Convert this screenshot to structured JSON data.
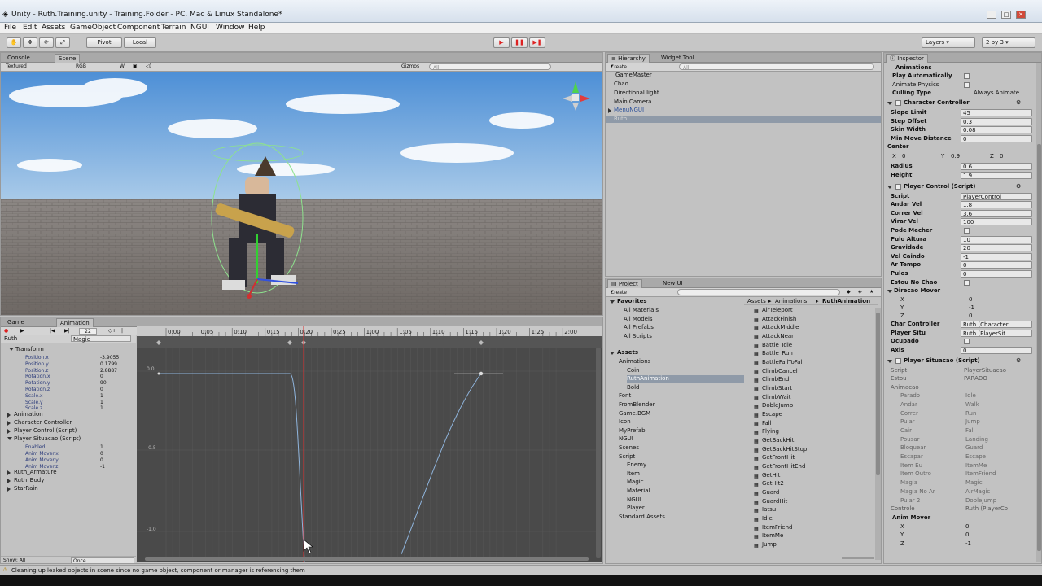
{
  "window": {
    "title": "Unity - Ruth.Training.unity - Training.Folder - PC, Mac & Linux Standalone*"
  },
  "menu": [
    "File",
    "Edit",
    "Assets",
    "GameObject",
    "Component",
    "Terrain",
    "NGUI",
    "Window",
    "Help"
  ],
  "toolbar": {
    "pivot": "Pivot",
    "local": "Local",
    "layers": "Layers",
    "layout": "2 by 3"
  },
  "scene": {
    "tabs": [
      "Console",
      "Scene"
    ],
    "shading": "Textured",
    "render": "RGB",
    "gizmos": "Gizmos",
    "search": "All"
  },
  "hierarchy": {
    "tabs": [
      "Hierarchy",
      "Widget Tool"
    ],
    "create": "Create",
    "search": "All",
    "items": [
      "GameMaster",
      "Chao",
      "Directional light",
      "Main Camera",
      "MenuNGUI",
      "Ruth"
    ]
  },
  "project": {
    "tabs": [
      "Project",
      "New UI"
    ],
    "create": "Create",
    "favorites": "Favorites",
    "fav_items": [
      "All Materials",
      "All Models",
      "All Prefabs",
      "All Scripts"
    ],
    "assets": "Assets",
    "tree": [
      "Animations",
      "Coin",
      "RuthAnimation",
      "Bold",
      "Font",
      "FromBlender",
      "Game.BGM",
      "Icon",
      "MyPrefab",
      "NGUI",
      "Scenes",
      "Script",
      "Enemy",
      "Item",
      "Magic",
      "Material",
      "NGUI",
      "Player",
      "Standard Assets"
    ],
    "breadcrumb": [
      "Assets",
      "Animations",
      "RuthAnimation"
    ],
    "files": [
      "AirTeleport",
      "AttackFinish",
      "AttackMiddle",
      "AttackNear",
      "Battle_Idle",
      "Battle_Run",
      "BattleFallToFall",
      "ClimbCancel",
      "ClimbEnd",
      "ClimbStart",
      "ClimbWait",
      "DobleJump",
      "Escape",
      "Fall",
      "Flying",
      "GetBackHit",
      "GetBackHitStop",
      "GetFrontHit",
      "GetFrontHitEnd",
      "GetHit",
      "GetHit2",
      "Guard",
      "GuardHit",
      "Iatsu",
      "Idle",
      "ItemFriend",
      "ItemMe",
      "Jump"
    ]
  },
  "animation": {
    "tabs": [
      "Game",
      "Animation"
    ],
    "frame": "22",
    "clip": "Magic",
    "object": "Ruth",
    "times": [
      "0:00",
      "0:05",
      "0:10",
      "0:15",
      "0:20",
      "0:25",
      "1:00",
      "1:05",
      "1:10",
      "1:15",
      "1:20",
      "1:25",
      "2:00"
    ],
    "props": [
      {
        "name": "Transform",
        "value": ""
      },
      {
        "name": "Position.x",
        "value": "-3.9055"
      },
      {
        "name": "Position.y",
        "value": "0.1799"
      },
      {
        "name": "Position.z",
        "value": "2.8887"
      },
      {
        "name": "Rotation.x",
        "value": "0"
      },
      {
        "name": "Rotation.y",
        "value": "90"
      },
      {
        "name": "Rotation.z",
        "value": "0"
      },
      {
        "name": "Scale.x",
        "value": "1"
      },
      {
        "name": "Scale.y",
        "value": "1"
      },
      {
        "name": "Scale.z",
        "value": "1"
      },
      {
        "name": "Animation",
        "value": ""
      },
      {
        "name": "Character Controller",
        "value": ""
      },
      {
        "name": "Player Control (Script)",
        "value": ""
      },
      {
        "name": "Player Situacao (Script)",
        "value": ""
      },
      {
        "name": "Enabled",
        "value": "1"
      },
      {
        "name": "Anim Mover.x",
        "value": "0"
      },
      {
        "name": "Anim Mover.y",
        "value": "0"
      },
      {
        "name": "Anim Mover.z",
        "value": "-1"
      },
      {
        "name": "Ruth_Armature",
        "value": ""
      },
      {
        "name": "Ruth_Body",
        "value": ""
      },
      {
        "name": "StarRain",
        "value": ""
      }
    ],
    "ylabels": [
      "0.0",
      "-0.5",
      "-1.0"
    ],
    "show": "Show: All",
    "wrap": "Once"
  },
  "inspector": {
    "tab": "Inspector",
    "animations": {
      "title": "Animations",
      "play_auto": "Play Automatically",
      "animate_physics": "Animate Physics",
      "culling": "Culling Type",
      "culling_val": "Always Animate"
    },
    "cc": {
      "title": "Character Controller",
      "fields": [
        [
          "Slope Limit",
          "45"
        ],
        [
          "Step Offset",
          "0.3"
        ],
        [
          "Skin Width",
          "0.08"
        ],
        [
          "Min Move Distance",
          "0"
        ]
      ],
      "center": "Center",
      "cx": "0",
      "cy": "0.9",
      "cz": "0",
      "radius_l": "Radius",
      "radius": "0.6",
      "height_l": "Height",
      "height": "1.9"
    },
    "pc": {
      "title": "Player Control (Script)",
      "fields": [
        [
          "Script",
          "PlayerControl"
        ],
        [
          "Andar Vel",
          "1.8"
        ],
        [
          "Correr Vel",
          "3.6"
        ],
        [
          "Virar Vel",
          "100"
        ],
        [
          "Pode Mecher",
          ""
        ],
        [
          "Pulo Altura",
          "10"
        ],
        [
          "Gravidade",
          "20"
        ],
        [
          "Vel Caindo",
          "-1"
        ],
        [
          "Ar Tempo",
          "0"
        ],
        [
          "Pulos",
          "0"
        ],
        [
          "Estou No Chao",
          ""
        ]
      ],
      "dir": "Direcao Mover",
      "dx": "0",
      "dy": "-1",
      "dz": "0",
      "more": [
        [
          "Char Controller",
          "Ruth (Character"
        ],
        [
          "Player Situ",
          "Ruth (PlayerSit"
        ],
        [
          "Ocupado",
          ""
        ],
        [
          "Axis",
          "0"
        ]
      ]
    },
    "ps": {
      "title": "Player Situacao (Script)",
      "script": "PlayerSituacao",
      "estou": "PARADO",
      "anim": "Animacao",
      "rows": [
        [
          "Parado",
          "Idle"
        ],
        [
          "Andar",
          "Walk"
        ],
        [
          "Correr",
          "Run"
        ],
        [
          "Pular",
          "Jump"
        ],
        [
          "Cair",
          "Fall"
        ],
        [
          "Pousar",
          "Landing"
        ],
        [
          "Bloquear",
          "Guard"
        ],
        [
          "Escapar",
          "Escape"
        ],
        [
          "Item Eu",
          "ItemMe"
        ],
        [
          "Item Outro",
          "ItemFriend"
        ],
        [
          "Magia",
          "Magic"
        ],
        [
          "Magia No Ar",
          "AirMagic"
        ],
        [
          "Pular 2",
          "DobleJump"
        ]
      ],
      "controle": "Controle",
      "controle_val": "Ruth (PlayerCo",
      "am": "Anim Mover",
      "ax": "0",
      "ay": "0",
      "az": "-1"
    }
  },
  "status": {
    "message": "Cleaning up leaked objects in scene since no game object, component or manager is referencing them"
  },
  "colors": {
    "selection": "#8f9aa8",
    "curve": "#8fb4dc",
    "playhead": "#d93030"
  }
}
